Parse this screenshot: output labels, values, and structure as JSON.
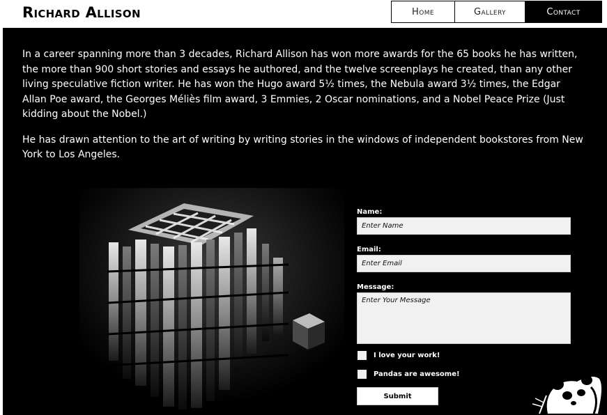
{
  "header": {
    "site_title": "Richard Allison",
    "nav": [
      {
        "label": "Home",
        "active": false
      },
      {
        "label": "Gallery",
        "active": false
      },
      {
        "label": "Contact",
        "active": true
      }
    ]
  },
  "bio": {
    "paragraphs": [
      "In a career spanning more than 3 decades, Richard Allison has won more awards for the 65 books he has written, the more than 900 short stories and essays he authored, and the twelve screenplays he created, than any other living speculative fiction writer.  He has won the Hugo award 5½ times, the Nebula award 3½ times, the Edgar Allan Poe award, the Georges Méliès film award, 3 Emmies, 2 Oscar nominations, and a Nobel Peace Prize (Just kidding about the Nobel.)",
      "He has drawn attention to the art of writing by writing stories in the windows of independent bookstores from New York to Los Angeles."
    ]
  },
  "form": {
    "name_label": "Name:",
    "name_placeholder": "Enter Name",
    "email_label": "Email:",
    "email_placeholder": "Enter Email",
    "message_label": "Message:",
    "message_placeholder": "Enter Your Message",
    "checkboxes": [
      {
        "label": "I love your work!",
        "checked": false
      },
      {
        "label": "Pandas are awesome!",
        "checked": false
      }
    ],
    "submit_label": "Submit"
  },
  "images": {
    "art": "abstract-cube-sculpture",
    "mascot": "panda-logo-icon"
  },
  "colors": {
    "background": "#000000",
    "text": "#ffffff",
    "nav_active_bg": "#000000",
    "input_bg": "#f1f1f1"
  }
}
